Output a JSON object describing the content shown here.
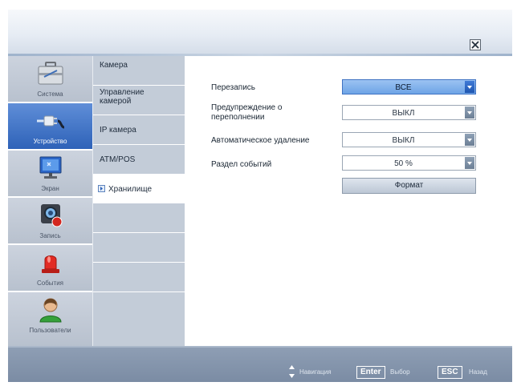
{
  "window": {
    "close_label": "×"
  },
  "sidebar": {
    "categories": [
      {
        "label": "Система",
        "icon": "toolbox-icon"
      },
      {
        "label": "Устройство",
        "icon": "network-plug-icon",
        "active": true
      },
      {
        "label": "Экран",
        "icon": "monitor-icon"
      },
      {
        "label": "Запись",
        "icon": "camera-record-icon"
      },
      {
        "label": "События",
        "icon": "alarm-light-icon"
      },
      {
        "label": "Пользователи",
        "icon": "user-icon"
      }
    ]
  },
  "submenu": {
    "items": [
      {
        "label": "Камера"
      },
      {
        "label": "Управление камерой"
      },
      {
        "label": "IP камера"
      },
      {
        "label": "ATM/POS"
      },
      {
        "label": "Хранилище",
        "active": true
      }
    ]
  },
  "settings": {
    "overwrite": {
      "label": "Перезапись",
      "value": "ВСЕ"
    },
    "overflow_warning": {
      "label": "Предупреждение о переполнении",
      "value": "ВЫКЛ"
    },
    "auto_delete": {
      "label": "Автоматическое удаление",
      "value": "ВЫКЛ"
    },
    "event_partition": {
      "label": "Раздел событий",
      "value": "50 %"
    },
    "format_button": "Формат"
  },
  "footer": {
    "navigation": "Навигация",
    "enter_key": "Enter",
    "select": "Выбор",
    "esc_key": "ESC",
    "back": "Назад"
  },
  "colors": {
    "accent": "#2e62b8",
    "highlight": "#6da4e6",
    "footer": "#7a8ba3"
  }
}
